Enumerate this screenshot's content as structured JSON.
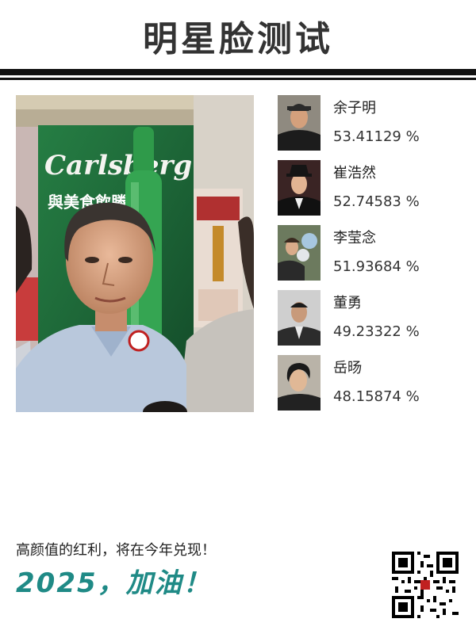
{
  "header": {
    "title": "明星脸测试"
  },
  "main_photo": {
    "description_icon": "main-face-photo",
    "poster_logo": "Carlsberg",
    "poster_slogan": "與美食飲勝!"
  },
  "matches": [
    {
      "name": "余子明",
      "score": "53.41129 %",
      "thumb_icon": "celebrity-photo"
    },
    {
      "name": "崔浩然",
      "score": "52.74583 %",
      "thumb_icon": "celebrity-photo"
    },
    {
      "name": "李莹念",
      "score": "51.93684 %",
      "thumb_icon": "celebrity-photo"
    },
    {
      "name": "董勇",
      "score": "49.23322 %",
      "thumb_icon": "celebrity-photo"
    },
    {
      "name": "岳旸",
      "score": "48.15874 %",
      "thumb_icon": "celebrity-photo"
    }
  ],
  "footer": {
    "caption": "高颜值的红利，将在今年兑现！",
    "slogan": "2025，加油！",
    "qr_icon": "qr-code"
  },
  "colors": {
    "title": "#333333",
    "rule": "#111111",
    "slogan": "#1f8a86"
  }
}
